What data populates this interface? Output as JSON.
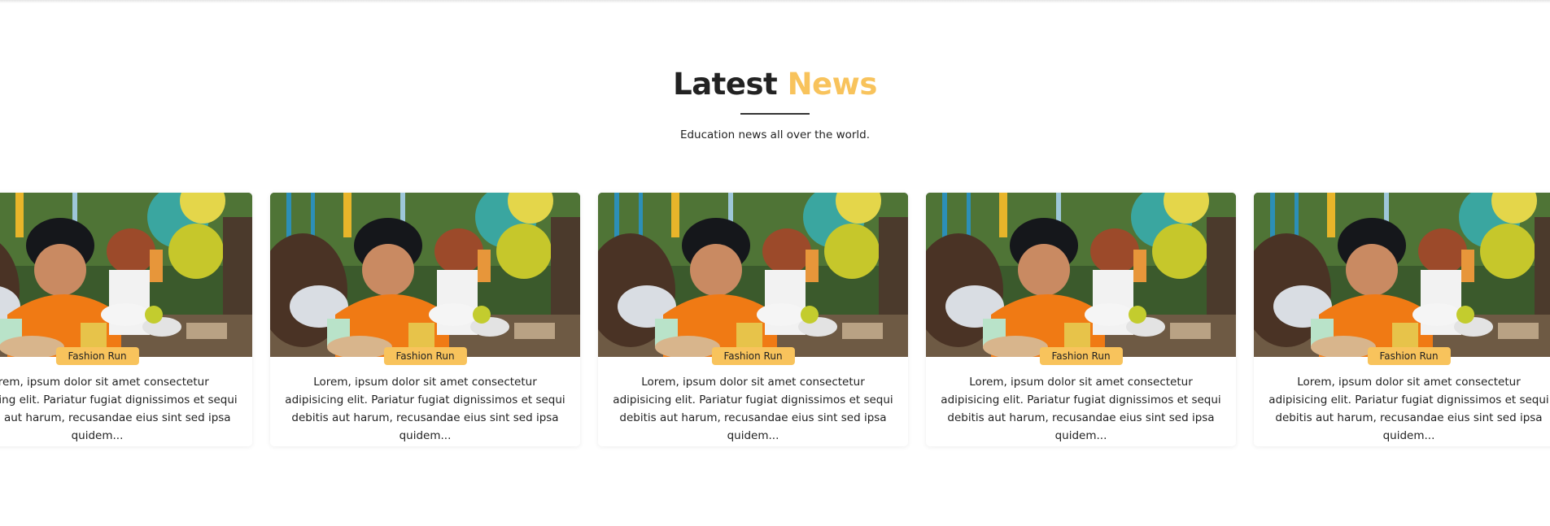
{
  "section": {
    "title_word_1": "Latest",
    "title_word_2": "News",
    "subtitle": "Education news all over the world."
  },
  "colors": {
    "accent": "#f8c35c",
    "title": "#222222"
  },
  "image_alt": "Children doing crafts at an outdoor party table with balloons",
  "cards": [
    {
      "tag": "Fashion Run",
      "text": "Lorem, ipsum dolor sit amet consectetur adipisicing elit. Pariatur fugiat dignissimos et sequi debitis aut harum, recusandae eius sint sed ipsa quidem..."
    },
    {
      "tag": "Fashion Run",
      "text": "Lorem, ipsum dolor sit amet consectetur adipisicing elit. Pariatur fugiat dignissimos et sequi debitis aut harum, recusandae eius sint sed ipsa quidem..."
    },
    {
      "tag": "Fashion Run",
      "text": "Lorem, ipsum dolor sit amet consectetur adipisicing elit. Pariatur fugiat dignissimos et sequi debitis aut harum, recusandae eius sint sed ipsa quidem..."
    },
    {
      "tag": "Fashion Run",
      "text": "Lorem, ipsum dolor sit amet consectetur adipisicing elit. Pariatur fugiat dignissimos et sequi debitis aut harum, recusandae eius sint sed ipsa quidem..."
    },
    {
      "tag": "Fashion Run",
      "text": "Lorem, ipsum dolor sit amet consectetur adipisicing elit. Pariatur fugiat dignissimos et sequi debitis aut harum, recusandae eius sint sed ipsa quidem..."
    }
  ]
}
